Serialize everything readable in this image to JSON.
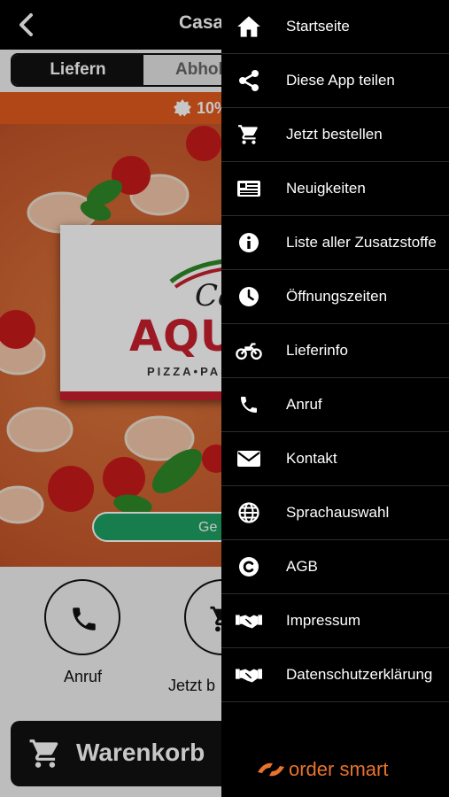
{
  "header": {
    "title": "Casa",
    "back_icon": "chevron-left-icon"
  },
  "order_mode": {
    "options": [
      "Liefern",
      "Abholen"
    ],
    "selected": "Liefern"
  },
  "promo": {
    "text": "10%",
    "icon": "badge-icon",
    "color": "#e35a1e"
  },
  "restaurant_logo": {
    "script_text": "Ca",
    "main_text": "AQU",
    "subtitle": "PIZZA•PAS"
  },
  "geo_button": {
    "label": "Ge"
  },
  "quick_actions": [
    {
      "label": "Anruf",
      "icon": "phone-icon"
    },
    {
      "label": "Jetzt b",
      "icon": "cart-icon"
    }
  ],
  "cart": {
    "label": "Warenkorb",
    "icon": "cart-icon"
  },
  "menu": {
    "items": [
      {
        "label": "Startseite",
        "icon": "home-icon"
      },
      {
        "label": "Diese App teilen",
        "icon": "share-icon"
      },
      {
        "label": "Jetzt bestellen",
        "icon": "cart-icon"
      },
      {
        "label": "Neuigkeiten",
        "icon": "news-icon"
      },
      {
        "label": "Liste aller Zusatzstoffe",
        "icon": "info-icon"
      },
      {
        "label": "Öffnungszeiten",
        "icon": "clock-icon"
      },
      {
        "label": "Lieferinfo",
        "icon": "motorbike-icon"
      },
      {
        "label": "Anruf",
        "icon": "phone-icon"
      },
      {
        "label": "Kontakt",
        "icon": "envelope-icon"
      },
      {
        "label": "Sprachauswahl",
        "icon": "globe-icon"
      },
      {
        "label": "AGB",
        "icon": "copyright-icon"
      },
      {
        "label": "Impressum",
        "icon": "handshake-icon"
      },
      {
        "label": "Datenschutzerklärung",
        "icon": "handshake-icon"
      }
    ]
  },
  "footer": {
    "brand": "order smart",
    "brand_color": "#e8732a"
  },
  "colors": {
    "accent_green": "#1ea063",
    "brand_red": "#c8202f",
    "drawer_bg": "#000000"
  }
}
